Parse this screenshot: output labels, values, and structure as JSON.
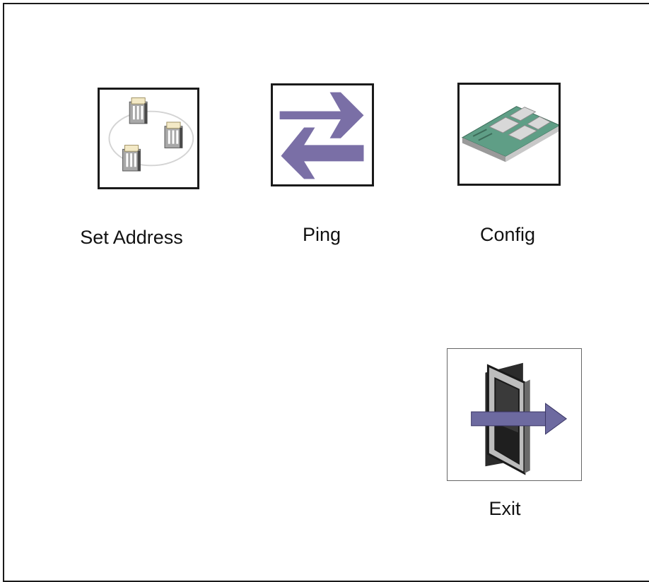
{
  "menu": {
    "items": [
      {
        "label": "Set Address",
        "icon": "network-nodes-icon"
      },
      {
        "label": "Ping",
        "icon": "transfer-arrows-icon"
      },
      {
        "label": "Config",
        "icon": "circuit-board-icon"
      },
      {
        "label": "Exit",
        "icon": "exit-door-icon"
      }
    ]
  },
  "colors": {
    "arrow": "#7a6fa6",
    "board": "#5f9e86",
    "frame": "#1a1a1a"
  }
}
